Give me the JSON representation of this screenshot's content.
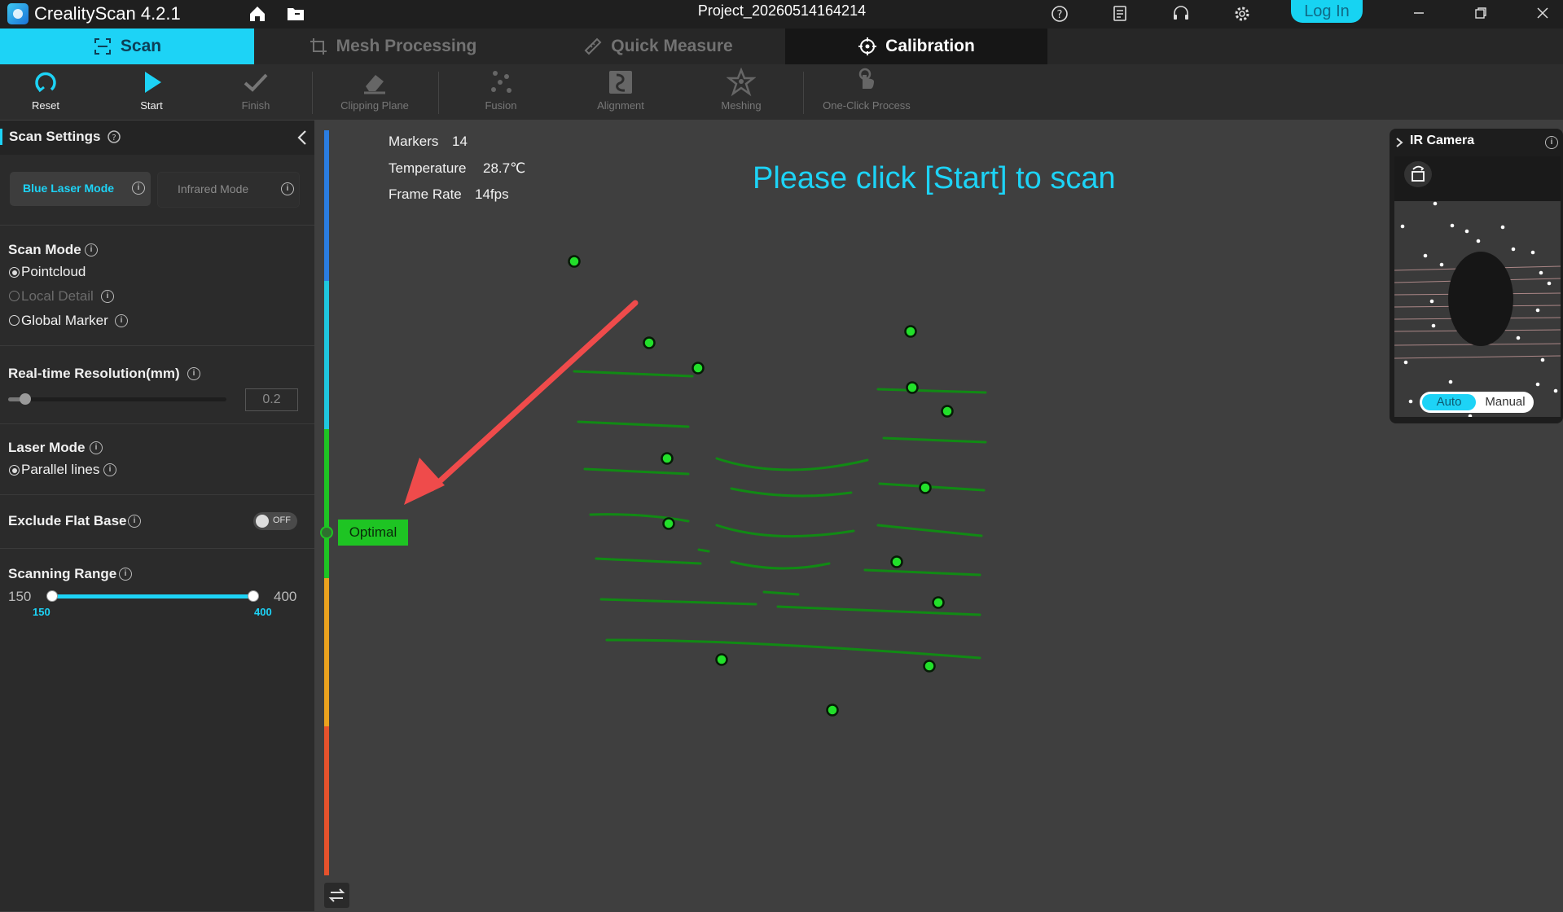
{
  "app": {
    "title": "CrealityScan 4.2.1",
    "project": "Project_20260514164214"
  },
  "titlebar": {
    "login_label": "Log In"
  },
  "tabs": [
    {
      "label": "Scan"
    },
    {
      "label": "Mesh Processing"
    },
    {
      "label": "Quick Measure"
    },
    {
      "label": "Calibration"
    }
  ],
  "toolbar": {
    "reset": "Reset",
    "start": "Start",
    "finish": "Finish",
    "clipping": "Clipping Plane",
    "fusion": "Fusion",
    "alignment": "Alignment",
    "meshing": "Meshing",
    "oneclick": "One-Click Process"
  },
  "settings": {
    "title": "Scan Settings",
    "modes": {
      "blue": "Blue Laser Mode",
      "infrared": "Infrared Mode"
    },
    "scan_mode": {
      "label": "Scan Mode",
      "options": [
        "Pointcloud",
        "Local Detail",
        "Global Marker"
      ],
      "selected": "Pointcloud"
    },
    "resolution": {
      "label": "Real-time Resolution(mm)",
      "value": "0.2"
    },
    "laser_mode": {
      "label": "Laser Mode",
      "option": "Parallel lines"
    },
    "exclude_flat": {
      "label": "Exclude Flat Base",
      "state": "OFF"
    },
    "range": {
      "label": "Scanning Range",
      "min_label": "150",
      "max_label": "400",
      "low": "150",
      "high": "400"
    }
  },
  "viewport": {
    "markers_label": "Markers",
    "markers_value": "14",
    "temp_label": "Temperature",
    "temp_value": "28.7℃",
    "fps_label": "Frame Rate",
    "fps_value": "14fps",
    "prompt": "Please click [Start] to scan",
    "distance_status": "Optimal"
  },
  "ir_camera": {
    "title": "IR Camera",
    "auto": "Auto",
    "manual": "Manual"
  },
  "colors": {
    "accent": "#1dd3f6",
    "marker": "#22e02a",
    "line": "#118a14",
    "arrow": "#ef4b4b"
  }
}
